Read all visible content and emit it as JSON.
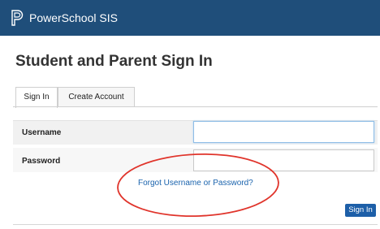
{
  "header": {
    "brand": "PowerSchool SIS",
    "logo_icon": "powerschool-logo-icon",
    "background": "#1f4e7a"
  },
  "main": {
    "title": "Student and Parent Sign In",
    "tabs": [
      {
        "label": "Sign In",
        "active": true
      },
      {
        "label": "Create Account",
        "active": false
      }
    ],
    "form": {
      "username_label": "Username",
      "username_value": "",
      "password_label": "Password",
      "password_value": "",
      "forgot_link": "Forgot Username or Password?",
      "submit_label": "Sign In"
    }
  },
  "annotation": {
    "type": "red-oval-highlight",
    "color": "#e0342b"
  },
  "colors": {
    "link": "#1a63ad",
    "button": "#1d5fa8"
  }
}
